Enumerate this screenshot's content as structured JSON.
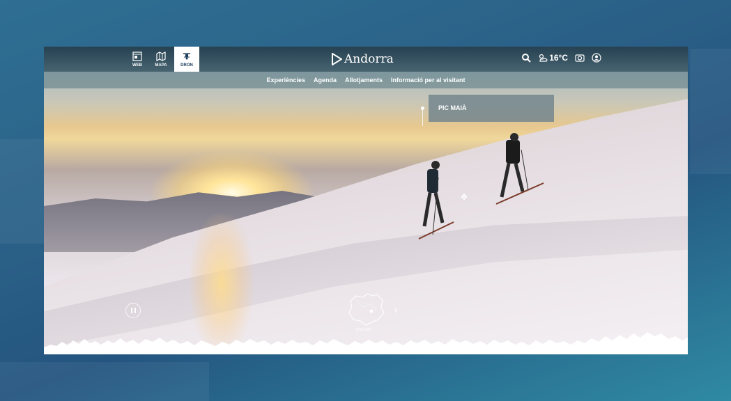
{
  "header": {
    "modes": [
      {
        "label": "WEB",
        "icon": "web-icon",
        "active": false
      },
      {
        "label": "MAPA",
        "icon": "map-icon",
        "active": false
      },
      {
        "label": "DRON",
        "icon": "drone-icon",
        "active": true
      }
    ],
    "logo_text": "Andorra",
    "weather": {
      "temperature": "16°C",
      "icon": "sun-cloud-icon"
    },
    "icons": [
      "search-icon",
      "camera-icon",
      "user-icon"
    ]
  },
  "nav": {
    "items": [
      "Experiències",
      "Agenda",
      "Allotjaments",
      "Informació per al visitant"
    ]
  },
  "poi": {
    "label": "PIC MAIÀ"
  },
  "minimap": {
    "place": "ENCAMP"
  },
  "colors": {
    "accent_active": "#ffffff",
    "bar": "#1e3c4f"
  }
}
